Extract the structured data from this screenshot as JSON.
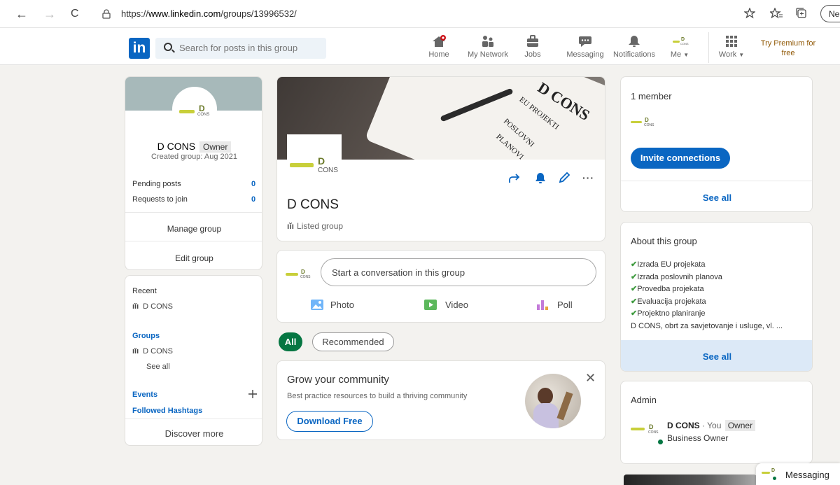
{
  "browser": {
    "back_glyph": "←",
    "forward_glyph": "→",
    "reload_glyph": "C",
    "url_prefix": "https://",
    "url_domain": "www.linkedin.com",
    "url_path": "/groups/13996532/",
    "ne_label": "Ne"
  },
  "nav": {
    "logo_text": "in",
    "search_placeholder": "Search for posts in this group",
    "items": [
      {
        "label": "Home"
      },
      {
        "label": "My Network"
      },
      {
        "label": "Jobs"
      },
      {
        "label": "Messaging"
      },
      {
        "label": "Notifications"
      },
      {
        "label": "Me"
      },
      {
        "label": "Work"
      }
    ],
    "premium_label": "Try Premium for free"
  },
  "left": {
    "group_name": "D CONS",
    "owner_badge": "Owner",
    "created": "Created group: Aug 2021",
    "pending_label": "Pending posts",
    "pending_value": "0",
    "requests_label": "Requests to join",
    "requests_value": "0",
    "manage_label": "Manage group",
    "edit_label": "Edit group",
    "recent_label": "Recent",
    "recent_item": "D CONS",
    "groups_label": "Groups",
    "groups_item": "D CONS",
    "see_all_label": "See all",
    "events_label": "Events",
    "hashtags_label": "Followed Hashtags",
    "discover_label": "Discover more"
  },
  "logo": {
    "d": "D",
    "cons": "CONS"
  },
  "banner": {
    "text1": "D CONS",
    "text2": "EU PROJEKTI",
    "text3": "POSLOVNI",
    "text4": "PLANOVI"
  },
  "center": {
    "group_title": "D CONS",
    "listed_label": "Listed group",
    "conversation_placeholder": "Start a conversation in this group",
    "photo_label": "Photo",
    "video_label": "Video",
    "poll_label": "Poll",
    "filter_all": "All",
    "filter_recommended": "Recommended",
    "grow_title": "Grow your community",
    "grow_subtitle": "Best practice resources to build a thriving community",
    "download_label": "Download Free",
    "close_glyph": "✕"
  },
  "right": {
    "members_label": "1 member",
    "invite_label": "Invite connections",
    "see_all_label": "See all",
    "about_title": "About this group",
    "about_items": [
      "Izrada EU projekata",
      "Izrada poslovnih planova",
      "Provedba projekata",
      "Evaluacija projekata",
      "Projektno planiranje"
    ],
    "about_desc": "D CONS, obrt za savjetovanje i usluge, vl. ...",
    "about_see_all": "See all",
    "admin_title": "Admin",
    "admin_name": "D CONS",
    "admin_you": " · You",
    "admin_badge": "Owner",
    "admin_role": "Business Owner"
  },
  "messaging": {
    "label": "Messaging"
  },
  "colors": {
    "brand": "#0a66c2",
    "page_bg": "#f3f2ef",
    "check_green": "#3d9a3d",
    "premium_gold": "#915907",
    "notification_red": "#cc1016"
  }
}
